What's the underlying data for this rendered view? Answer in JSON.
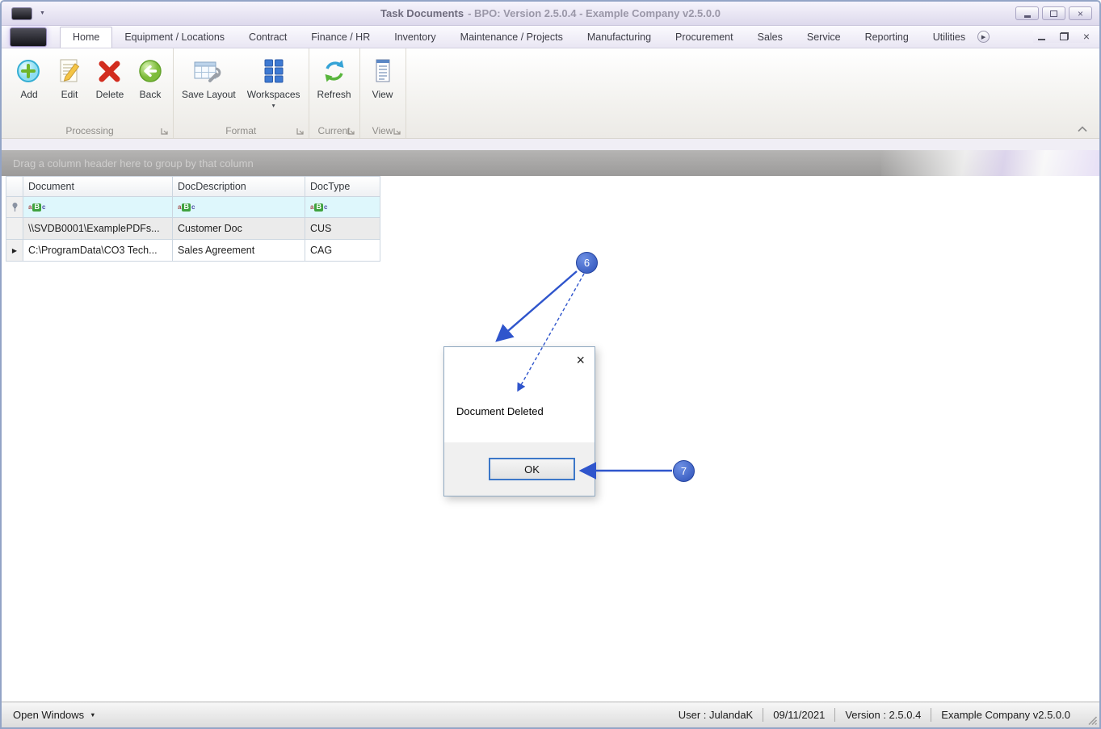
{
  "window": {
    "title_primary": "Task Documents",
    "title_secondary": "- BPO: Version 2.5.0.4 - Example Company v2.5.0.0"
  },
  "tabs": [
    "Home",
    "Equipment / Locations",
    "Contract",
    "Finance / HR",
    "Inventory",
    "Maintenance / Projects",
    "Manufacturing",
    "Procurement",
    "Sales",
    "Service",
    "Reporting",
    "Utilities"
  ],
  "active_tab": "Home",
  "ribbon": {
    "groups": [
      {
        "label": "Processing",
        "buttons": [
          {
            "label": "Add"
          },
          {
            "label": "Edit"
          },
          {
            "label": "Delete"
          },
          {
            "label": "Back"
          }
        ]
      },
      {
        "label": "Format",
        "buttons": [
          {
            "label": "Save Layout"
          },
          {
            "label": "Workspaces"
          }
        ]
      },
      {
        "label": "Current",
        "buttons": [
          {
            "label": "Refresh"
          }
        ]
      },
      {
        "label": "View",
        "buttons": [
          {
            "label": "View"
          }
        ]
      }
    ]
  },
  "grid": {
    "group_hint": "Drag a column header here to group by that column",
    "columns": [
      "Document",
      "DocDescription",
      "DocType"
    ],
    "filter_glyph": [
      "a",
      "B",
      "c"
    ],
    "rows": [
      {
        "document": "\\\\SVDB0001\\ExamplePDFs...",
        "description": "Customer Doc",
        "doctype": "CUS"
      },
      {
        "document": "C:\\ProgramData\\CO3 Tech...",
        "description": "Sales Agreement",
        "doctype": "CAG"
      }
    ]
  },
  "dialog": {
    "message": "Document Deleted",
    "ok_label": "OK"
  },
  "annotations": [
    {
      "label": "6"
    },
    {
      "label": "7"
    }
  ],
  "statusbar": {
    "open_windows": "Open Windows",
    "user": "User : JulandaK",
    "date": "09/11/2021",
    "version": "Version : 2.5.0.4",
    "company": "Example Company v2.5.0.0"
  },
  "icons": {
    "caret_down": "▼",
    "row_arrow": "▶",
    "scroll_arrow": "▶",
    "close_glyph": "×"
  },
  "colors": {
    "annotation-blue": "#2f55cc",
    "badge-fill": "#3a64d2",
    "filter-row-bg": "#def7fc",
    "ok-border": "#3c77c8",
    "titlebar-tint": "#ddd9ec"
  }
}
